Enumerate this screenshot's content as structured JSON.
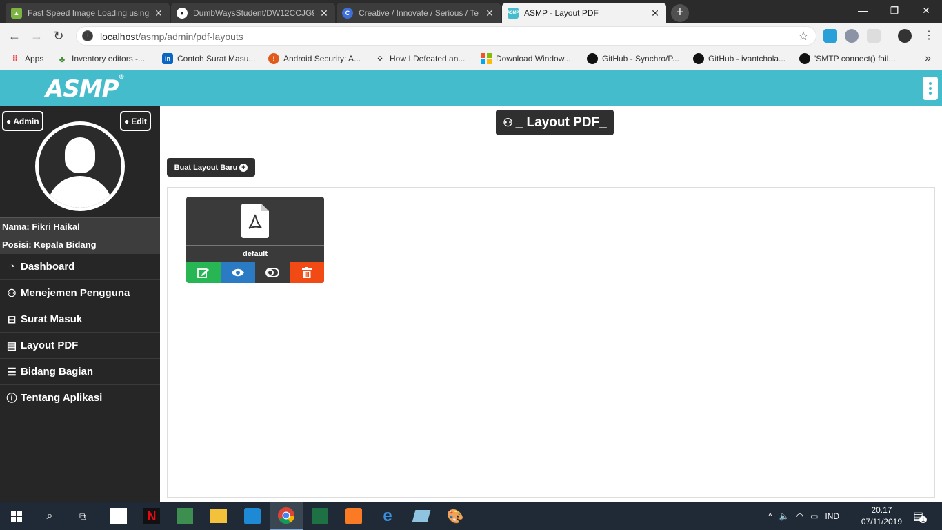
{
  "browser": {
    "tabs": [
      {
        "title": "Fast Speed Image Loading using",
        "active": false
      },
      {
        "title": "DumbWaysStudent/DW12CCJG9",
        "active": false
      },
      {
        "title": "Creative / Innovate / Serious / Te",
        "active": false
      },
      {
        "title": "ASMP - Layout PDF",
        "active": true
      }
    ],
    "url_host": "localhost",
    "url_path": "/asmp/admin/pdf-layouts",
    "bookmarks": [
      "Apps",
      "Inventory editors -...",
      "Contoh Surat Masu...",
      "Android Security: A...",
      "How I Defeated an...",
      "Download Window...",
      "GitHub - Synchro/P...",
      "GitHub - ivantchola...",
      "'SMTP connect() fail..."
    ]
  },
  "app": {
    "logo": "ASMP",
    "logo_mark": "®",
    "accent": "#45bccb"
  },
  "sidebar": {
    "admin_label": "Admin",
    "edit_label": "Edit",
    "nama": "Nama: Fikri Haikal",
    "posisi": "Posisi: Kepala Bidang",
    "items": [
      {
        "label": "Dashboard",
        "icon": "dashboard-icon"
      },
      {
        "label": "Menejemen Pengguna",
        "icon": "users-icon"
      },
      {
        "label": "Surat Masuk",
        "icon": "inbox-icon"
      },
      {
        "label": "Layout PDF",
        "icon": "pdf-file-icon"
      },
      {
        "label": "Bidang Bagian",
        "icon": "list-icon"
      },
      {
        "label": "Tentang Aplikasi",
        "icon": "info-icon"
      }
    ]
  },
  "main": {
    "title": "_ Layout PDF_",
    "new_button": "Buat Layout Baru",
    "layouts": [
      {
        "name": "default"
      }
    ],
    "action_colors": {
      "edit": "#28b654",
      "view": "#2a7ac4",
      "toggle": "#3a3a3a",
      "delete": "#f24a14"
    }
  },
  "taskbar": {
    "language": "IND",
    "time": "20.17",
    "date": "07/11/2019",
    "notifications": "1"
  }
}
